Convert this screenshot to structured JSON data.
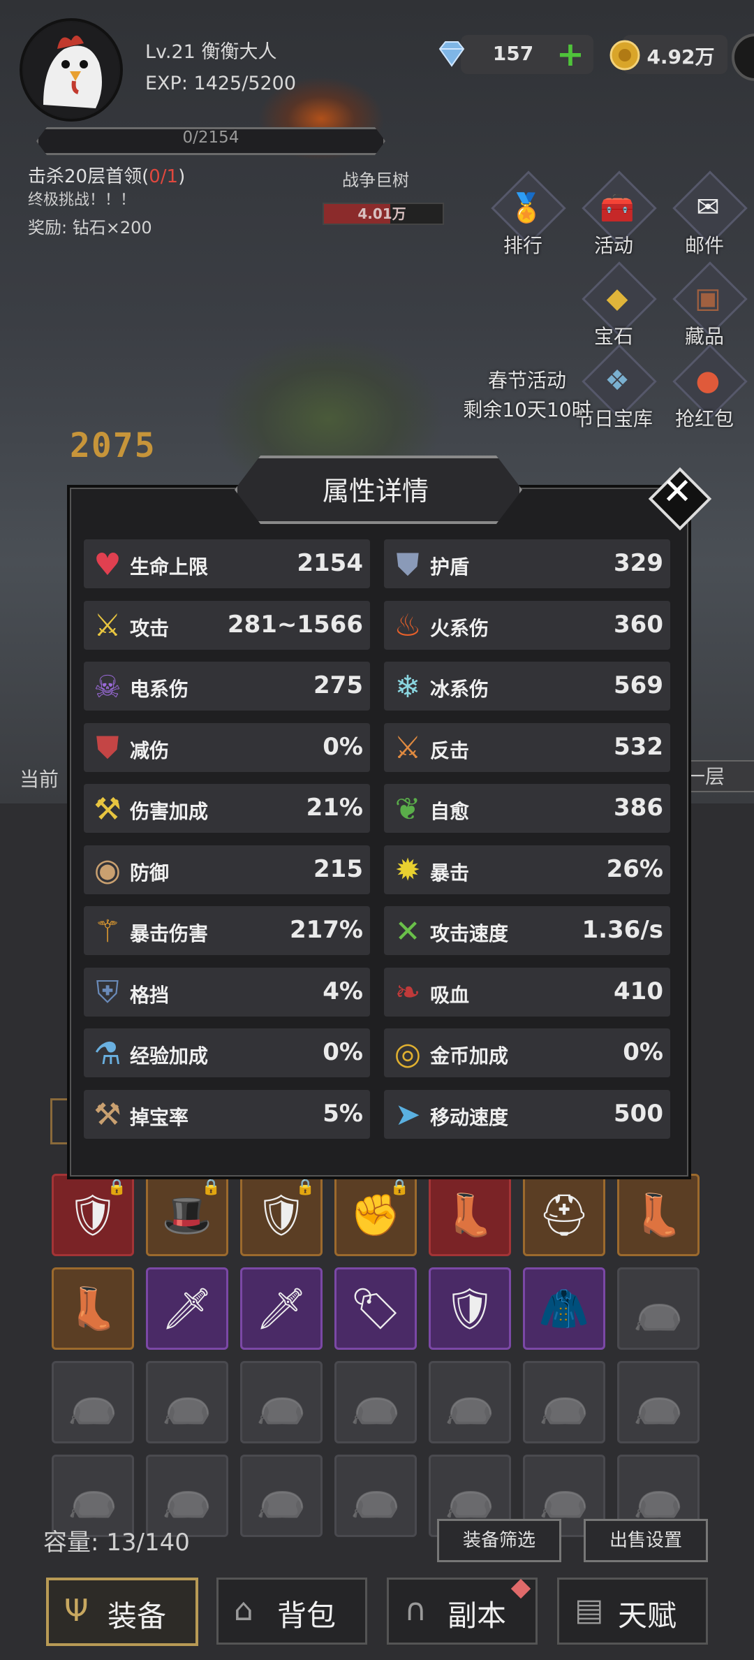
{
  "player": {
    "level_name": "Lv.21 衡衡大人",
    "exp": "EXP: 1425/5200",
    "hp_bar": "0/2154"
  },
  "currency": {
    "diamonds": "157",
    "gold": "4.92万"
  },
  "quest": {
    "title_prefix": "击杀20层首领(",
    "progress": "0/1",
    "title_suffix": ")",
    "desc": "终极挑战！！！",
    "reward": "奖励: 钻石×200"
  },
  "boss": {
    "name": "战争巨树",
    "hp": "4.01万",
    "hp_fraction": 0.56
  },
  "damage_number": "2075",
  "side_buttons": [
    "排行",
    "活动",
    "邮件",
    "宝石",
    "藏品",
    "节日宝库",
    "抢红包"
  ],
  "event": {
    "title": "春节活动",
    "remaining": "剩余10天10时"
  },
  "floor": {
    "current_label": "当前",
    "next_label": "一层"
  },
  "modal": {
    "title": "属性详情",
    "close": "✕",
    "stats_left": [
      {
        "name": "生命上限",
        "value": "2154",
        "icon": "heart-icon"
      },
      {
        "name": "攻击",
        "value": "281~1566",
        "icon": "sword-icon"
      },
      {
        "name": "电系伤",
        "value": "275",
        "icon": "lightning-skull-icon"
      },
      {
        "name": "减伤",
        "value": "0%",
        "icon": "shield-reduce-icon"
      },
      {
        "name": "伤害加成",
        "value": "21%",
        "icon": "hammer-icon"
      },
      {
        "name": "防御",
        "value": "215",
        "icon": "round-shield-icon"
      },
      {
        "name": "暴击伤害",
        "value": "217%",
        "icon": "triple-blade-icon"
      },
      {
        "name": "格挡",
        "value": "4%",
        "icon": "block-shield-icon"
      },
      {
        "name": "经验加成",
        "value": "0%",
        "icon": "exp-potion-icon"
      },
      {
        "name": "掉宝率",
        "value": "5%",
        "icon": "loot-axes-icon"
      }
    ],
    "stats_right": [
      {
        "name": "护盾",
        "value": "329",
        "icon": "shield-icon"
      },
      {
        "name": "火系伤",
        "value": "360",
        "icon": "fire-icon"
      },
      {
        "name": "冰系伤",
        "value": "569",
        "icon": "snowflake-icon"
      },
      {
        "name": "反击",
        "value": "532",
        "icon": "crossed-swords-icon"
      },
      {
        "name": "自愈",
        "value": "386",
        "icon": "leaf-icon"
      },
      {
        "name": "暴击",
        "value": "26%",
        "icon": "crit-burst-icon"
      },
      {
        "name": "攻击速度",
        "value": "1.36/s",
        "icon": "crossed-arrows-icon"
      },
      {
        "name": "吸血",
        "value": "410",
        "icon": "bat-icon"
      },
      {
        "name": "金币加成",
        "value": "0%",
        "icon": "gold-coin-icon"
      },
      {
        "name": "移动速度",
        "value": "500",
        "icon": "boot-speed-icon"
      }
    ]
  },
  "inventory": {
    "capacity": "容量: 13/140",
    "filter_button": "装备筛选",
    "sell_button": "出售设置",
    "slots": [
      {
        "rarity": "red",
        "icon": "armor-icon",
        "locked": true
      },
      {
        "rarity": "orange",
        "icon": "hat-icon",
        "locked": true
      },
      {
        "rarity": "orange",
        "icon": "armor-icon",
        "locked": true
      },
      {
        "rarity": "orange",
        "icon": "gauntlet-icon",
        "locked": true
      },
      {
        "rarity": "red",
        "icon": "boot-icon",
        "locked": false
      },
      {
        "rarity": "orange",
        "icon": "helmet-icon",
        "locked": false
      },
      {
        "rarity": "orange",
        "icon": "boot-icon",
        "locked": false
      },
      {
        "rarity": "orange",
        "icon": "boot-icon",
        "locked": false
      },
      {
        "rarity": "purple",
        "icon": "sword-icon",
        "locked": false
      },
      {
        "rarity": "purple",
        "icon": "sword-icon",
        "locked": false
      },
      {
        "rarity": "purple",
        "icon": "tag-icon",
        "locked": false
      },
      {
        "rarity": "purple",
        "icon": "armor-icon",
        "locked": false
      },
      {
        "rarity": "purple",
        "icon": "jacket-icon",
        "locked": false
      },
      {
        "rarity": "gray",
        "icon": "bag-icon",
        "locked": false
      }
    ]
  },
  "bottom_tabs": [
    {
      "label": "装备",
      "icon": "trident-icon",
      "active": true
    },
    {
      "label": "背包",
      "icon": "backpack-icon",
      "active": false
    },
    {
      "label": "副本",
      "icon": "portal-icon",
      "active": false
    },
    {
      "label": "天赋",
      "icon": "cards-icon",
      "active": false
    }
  ]
}
